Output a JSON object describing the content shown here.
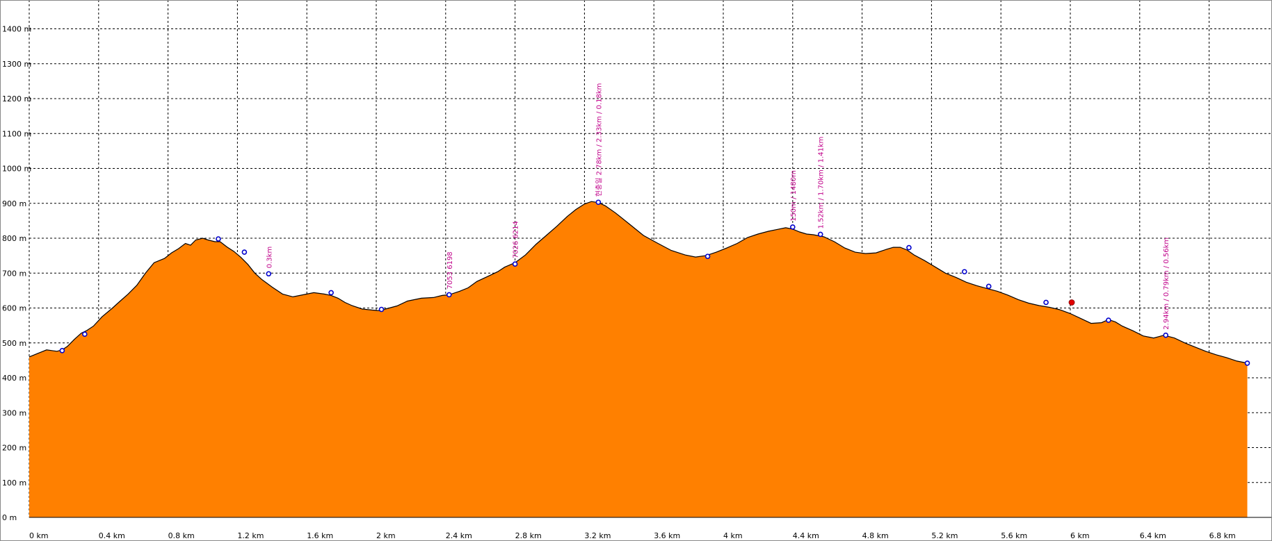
{
  "chart_data": {
    "type": "area",
    "title": "",
    "xlabel": "",
    "ylabel": "",
    "xlim": [
      0,
      7.0
    ],
    "ylim": [
      0,
      1450
    ],
    "grid": true,
    "y_ticks": [
      {
        "value": 0,
        "label": "0 m"
      },
      {
        "value": 100,
        "label": "100 m"
      },
      {
        "value": 200,
        "label": "200 m"
      },
      {
        "value": 300,
        "label": "300 m"
      },
      {
        "value": 400,
        "label": "400 m"
      },
      {
        "value": 500,
        "label": "500 m"
      },
      {
        "value": 600,
        "label": "600 m"
      },
      {
        "value": 700,
        "label": "700 m"
      },
      {
        "value": 800,
        "label": "800 m"
      },
      {
        "value": 900,
        "label": "900 m"
      },
      {
        "value": 1000,
        "label": "1000 m"
      },
      {
        "value": 1100,
        "label": "1100 m"
      },
      {
        "value": 1200,
        "label": "1200 m"
      },
      {
        "value": 1300,
        "label": "1300 m"
      },
      {
        "value": 1400,
        "label": "1400 m"
      }
    ],
    "x_ticks": [
      {
        "value": 0.0,
        "label": "0 km"
      },
      {
        "value": 0.4,
        "label": "0.4 km"
      },
      {
        "value": 0.8,
        "label": "0.8 km"
      },
      {
        "value": 1.2,
        "label": "1.2 km"
      },
      {
        "value": 1.6,
        "label": "1.6 km"
      },
      {
        "value": 2.0,
        "label": "2 km"
      },
      {
        "value": 2.4,
        "label": "2.4 km"
      },
      {
        "value": 2.8,
        "label": "2.8 km"
      },
      {
        "value": 3.2,
        "label": "3.2 km"
      },
      {
        "value": 3.6,
        "label": "3.6 km"
      },
      {
        "value": 4.0,
        "label": "4 km"
      },
      {
        "value": 4.4,
        "label": "4.4 km"
      },
      {
        "value": 4.8,
        "label": "4.8 km"
      },
      {
        "value": 5.2,
        "label": "5.2 km"
      },
      {
        "value": 5.6,
        "label": "5.6 km"
      },
      {
        "value": 6.0,
        "label": "6 km"
      },
      {
        "value": 6.4,
        "label": "6.4 km"
      },
      {
        "value": 6.8,
        "label": "6.8 km"
      }
    ],
    "series": [
      {
        "fill": "#ff8000",
        "stroke": "#000000",
        "x": [
          0.0,
          0.05,
          0.1,
          0.13,
          0.16,
          0.19,
          0.22,
          0.26,
          0.3,
          0.33,
          0.37,
          0.42,
          0.48,
          0.52,
          0.57,
          0.62,
          0.67,
          0.72,
          0.78,
          0.82,
          0.86,
          0.9,
          0.93,
          0.96,
          1.0,
          1.03,
          1.07,
          1.1,
          1.14,
          1.18,
          1.22,
          1.26,
          1.3,
          1.34,
          1.4,
          1.46,
          1.52,
          1.58,
          1.64,
          1.7,
          1.74,
          1.78,
          1.82,
          1.86,
          1.92,
          1.98,
          2.02,
          2.06,
          2.12,
          2.18,
          2.26,
          2.33,
          2.38,
          2.42,
          2.48,
          2.53,
          2.58,
          2.64,
          2.7,
          2.74,
          2.8,
          2.86,
          2.92,
          2.98,
          3.04,
          3.1,
          3.15,
          3.2,
          3.24,
          3.28,
          3.32,
          3.38,
          3.46,
          3.54,
          3.62,
          3.7,
          3.78,
          3.84,
          3.9,
          3.96,
          4.02,
          4.08,
          4.14,
          4.2,
          4.26,
          4.32,
          4.36,
          4.4,
          4.44,
          4.48,
          4.52,
          4.58,
          4.64,
          4.7,
          4.76,
          4.82,
          4.88,
          4.94,
          4.98,
          5.02,
          5.06,
          5.1,
          5.16,
          5.22,
          5.28,
          5.34,
          5.4,
          5.46,
          5.52,
          5.58,
          5.64,
          5.7,
          5.76,
          5.82,
          5.88,
          5.94,
          6.0,
          6.06,
          6.12,
          6.18,
          6.22,
          6.26,
          6.3,
          6.36,
          6.42,
          6.48,
          6.54,
          6.6,
          6.66,
          6.72,
          6.78,
          6.84,
          6.9,
          6.96,
          7.02
        ],
        "y": [
          460,
          470,
          480,
          478,
          476,
          480,
          490,
          510,
          528,
          535,
          548,
          575,
          600,
          618,
          640,
          665,
          700,
          730,
          742,
          758,
          770,
          785,
          780,
          795,
          800,
          795,
          790,
          790,
          775,
          762,
          745,
          725,
          700,
          682,
          660,
          640,
          632,
          638,
          644,
          640,
          636,
          628,
          616,
          607,
          597,
          594,
          592,
          598,
          606,
          620,
          628,
          630,
          636,
          638,
          648,
          658,
          676,
          690,
          704,
          717,
          730,
          752,
          782,
          808,
          834,
          862,
          882,
          898,
          905,
          902,
          893,
          872,
          840,
          808,
          786,
          765,
          752,
          746,
          750,
          760,
          772,
          785,
          802,
          812,
          820,
          826,
          830,
          826,
          818,
          812,
          810,
          804,
          790,
          772,
          760,
          756,
          758,
          768,
          774,
          774,
          766,
          752,
          736,
          718,
          700,
          688,
          674,
          664,
          656,
          648,
          637,
          624,
          614,
          607,
          602,
          595,
          584,
          570,
          556,
          558,
          567,
          560,
          548,
          535,
          520,
          514,
          522,
          514,
          500,
          488,
          476,
          466,
          458,
          448,
          442
        ]
      }
    ],
    "waypoints": [
      {
        "x": 0.19,
        "y": 478,
        "label": ""
      },
      {
        "x": 0.32,
        "y": 525,
        "label": ""
      },
      {
        "x": 1.09,
        "y": 798,
        "label": ""
      },
      {
        "x": 1.24,
        "y": 760,
        "label": ""
      },
      {
        "x": 1.38,
        "y": 698,
        "label": "0.3km"
      },
      {
        "x": 1.74,
        "y": 644,
        "label": ""
      },
      {
        "x": 2.03,
        "y": 596,
        "label": ""
      },
      {
        "x": 2.42,
        "y": 638,
        "label": "7053 6198"
      },
      {
        "x": 2.8,
        "y": 726,
        "label": "7026 6214"
      },
      {
        "x": 3.28,
        "y": 903,
        "label": "현충일 2.78km / 2.33km / 0.18km"
      },
      {
        "x": 3.91,
        "y": 748,
        "label": ""
      },
      {
        "x": 4.4,
        "y": 832,
        "label": "150m / 1480m"
      },
      {
        "x": 4.56,
        "y": 811,
        "label": "1.52km / 1.70km / 1.41km"
      },
      {
        "x": 5.07,
        "y": 773,
        "label": ""
      },
      {
        "x": 5.39,
        "y": 704,
        "label": ""
      },
      {
        "x": 5.53,
        "y": 662,
        "label": ""
      },
      {
        "x": 5.86,
        "y": 616,
        "label": ""
      },
      {
        "x": 6.22,
        "y": 565,
        "label": ""
      },
      {
        "x": 6.55,
        "y": 522,
        "label": "2.94km / 0.79km / 0.56km"
      },
      {
        "x": 7.02,
        "y": 442,
        "label": ""
      }
    ],
    "marker": {
      "x": 6.0,
      "y": 608,
      "color": "#e00000"
    }
  }
}
